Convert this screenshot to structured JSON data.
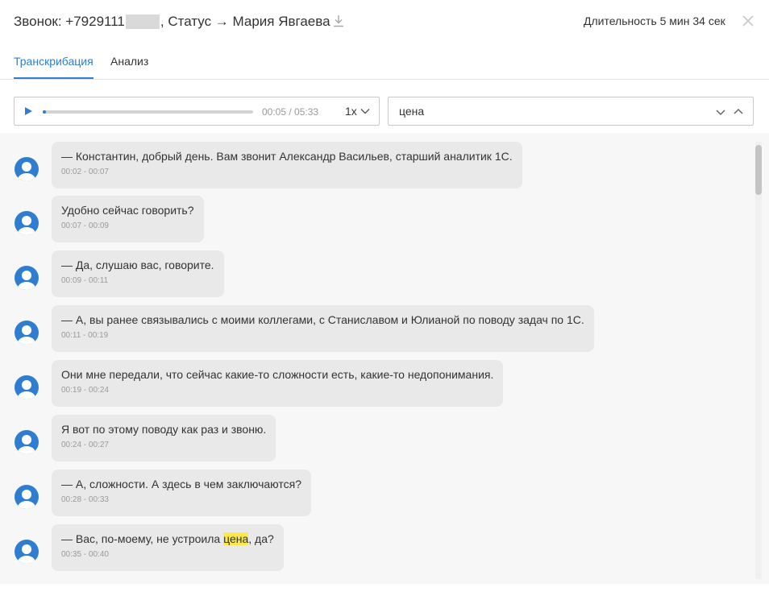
{
  "header": {
    "title_prefix": "Звонок: +7929111",
    "title_suffix": ", Статус → Мария Явгаева",
    "duration": "Длительность 5 мин 34 сек"
  },
  "tabs": [
    {
      "label": "Транскрибация",
      "active": true
    },
    {
      "label": "Анализ",
      "active": false
    }
  ],
  "player": {
    "current": "00:05",
    "total": "05:33",
    "time_display": "00:05 / 05:33",
    "speed": "1x",
    "progress": 0.015
  },
  "search": {
    "value": "цена"
  },
  "colors": {
    "accent": "#2f7dd1",
    "bubble": "#e9e9e9",
    "highlight": "#ffe84d",
    "background": "#f7f7f7"
  },
  "messages": [
    {
      "text": "— Константин, добрый день. Вам звонит Александр Васильев, старший аналитик 1С.",
      "time": "00:02 - 00:07"
    },
    {
      "text": "Удобно сейчас говорить?",
      "time": "00:07 - 00:09"
    },
    {
      "text": "— Да, слушаю вас, говорите.",
      "time": "00:09 - 00:11"
    },
    {
      "text": "— А, вы ранее связывались с моими коллегами, с Станиславом и Юлианой по поводу задач по 1С.",
      "time": "00:11 - 00:19"
    },
    {
      "text": "Они мне передали, что сейчас какие-то сложности есть, какие-то недопонимания.",
      "time": "00:19 - 00:24"
    },
    {
      "text": "Я вот по этому поводу как раз и звоню.",
      "time": "00:24 - 00:27"
    },
    {
      "text": "— А, сложности. А здесь в чем заключаются?",
      "time": "00:28 - 00:33"
    },
    {
      "text_before": "— Вас, по-моему, не устроила ",
      "text_highlight": "цена",
      "text_after": ", да?",
      "time": "00:35 - 00:40"
    }
  ]
}
